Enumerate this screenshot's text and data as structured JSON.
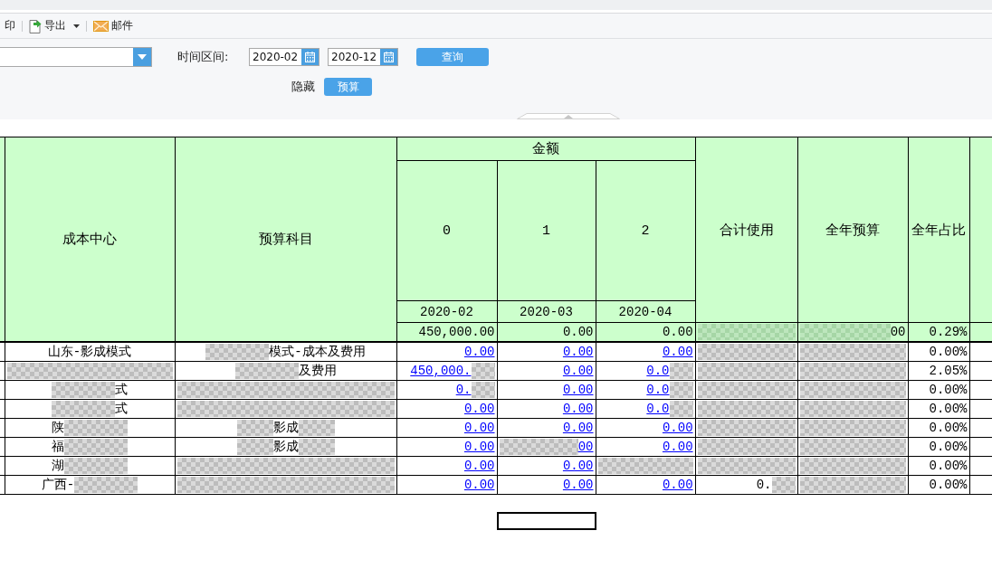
{
  "toolbar": {
    "items": [
      {
        "kind": "print",
        "label": "印"
      },
      {
        "kind": "export",
        "label": "导出"
      },
      {
        "kind": "mail",
        "label": "邮件"
      }
    ]
  },
  "filters": {
    "time_label": "时间区间:",
    "start_date": "2020-02",
    "end_date": "2020-12",
    "query_button": "查询",
    "hide_label": "隐藏",
    "budget_button": "预算"
  },
  "table": {
    "columns": [
      {
        "kind": "text",
        "heading": "成本中心"
      },
      {
        "kind": "text",
        "heading": "预算科目"
      },
      {
        "kind": "group",
        "heading": "金额",
        "colspan": 3,
        "columns": [
          {
            "heading": "0",
            "period": "2020-02"
          },
          {
            "heading": "1",
            "period": "2020-03"
          },
          {
            "heading": "2",
            "period": "2020-04"
          }
        ]
      },
      {
        "kind": "number",
        "heading": "合计使用"
      },
      {
        "kind": "number",
        "heading": "全年预算"
      },
      {
        "kind": "number",
        "heading": "全年占比"
      }
    ],
    "rows": [
      {
        "kind": "total",
        "cells": [
          {},
          {},
          {
            "text": "450,000.00"
          },
          {
            "text": "0.00"
          },
          {
            "text": "0.00"
          },
          {
            "masked": true
          },
          {
            "text": "00",
            "masked_before": true
          },
          {
            "text": "0.29%"
          }
        ]
      },
      {
        "kind": "detail",
        "cells": [
          {
            "text": "山东-影成模式"
          },
          {
            "text": "模式-成本及费用",
            "masked_before": true
          },
          {
            "text": "0.00"
          },
          {
            "text": "0.00"
          },
          {
            "text": "0.00"
          },
          {
            "masked": true
          },
          {
            "masked": true
          },
          {
            "text": "0.00%"
          }
        ]
      },
      {
        "kind": "detail",
        "cells": [
          {
            "masked": true
          },
          {
            "text": "及费用",
            "masked_before": true
          },
          {
            "text": "450,000.",
            "masked_after": true
          },
          {
            "text": "0.00"
          },
          {
            "text": "0.0",
            "masked_after": true
          },
          {
            "masked": true
          },
          {
            "masked": true
          },
          {
            "text": "2.05%"
          }
        ]
      },
      {
        "kind": "detail",
        "cells": [
          {
            "text": "式",
            "masked_before": true
          },
          {
            "masked": true
          },
          {
            "text": "0.",
            "masked_after": true
          },
          {
            "text": "0.00"
          },
          {
            "text": "0.0",
            "masked_after": true
          },
          {
            "masked": true
          },
          {
            "masked": true
          },
          {
            "text": "0.00%"
          }
        ]
      },
      {
        "kind": "detail",
        "cells": [
          {
            "text": "式",
            "masked_before": true
          },
          {
            "masked": true
          },
          {
            "text": "0.00"
          },
          {
            "text": "0.00"
          },
          {
            "text": "0.0",
            "masked_after": true
          },
          {
            "masked": true
          },
          {
            "masked": true
          },
          {
            "text": "0.00%"
          }
        ]
      },
      {
        "kind": "detail",
        "cells": [
          {
            "text": "陕",
            "masked_after": true
          },
          {
            "text": "影成",
            "masked_before": true,
            "masked_after": true
          },
          {
            "text": "0.00"
          },
          {
            "text": "0.00"
          },
          {
            "text": "0.00"
          },
          {
            "masked": true
          },
          {
            "masked": true
          },
          {
            "text": "0.00%"
          }
        ]
      },
      {
        "kind": "detail",
        "cells": [
          {
            "text": "福",
            "masked_after": true
          },
          {
            "text": "影成",
            "masked_before": true,
            "masked_after": true
          },
          {
            "text": "0.00"
          },
          {
            "text": "00",
            "masked_before": true
          },
          {
            "text": "0.00"
          },
          {
            "masked": true
          },
          {
            "masked": true
          },
          {
            "text": "0.00%"
          }
        ]
      },
      {
        "kind": "detail",
        "cells": [
          {
            "text": "湖",
            "masked_after": true
          },
          {
            "masked": true
          },
          {
            "text": "0.00"
          },
          {
            "text": "0.00"
          },
          {
            "masked": true
          },
          {
            "masked": true
          },
          {
            "masked": true
          },
          {
            "text": "0.00%"
          }
        ]
      },
      {
        "kind": "detail",
        "cells": [
          {
            "text": "广西-",
            "masked_after": true
          },
          {
            "masked": true
          },
          {
            "text": "0.00"
          },
          {
            "text": "0.00"
          },
          {
            "text": "0.00"
          },
          {
            "text": "0.",
            "masked_after": true
          },
          {
            "masked": true
          },
          {
            "text": "0.00%"
          }
        ]
      }
    ]
  }
}
